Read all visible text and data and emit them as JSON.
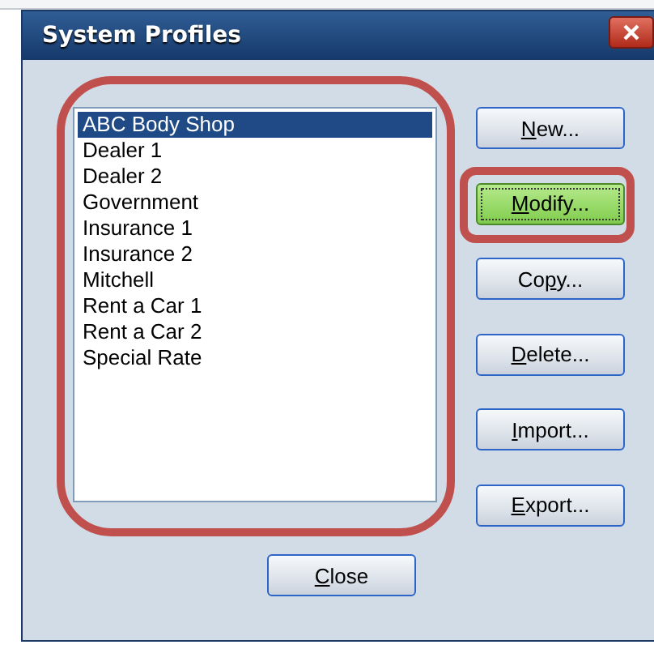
{
  "window": {
    "title": "System Profiles"
  },
  "profiles": [
    {
      "name": "ABC Body Shop",
      "selected": true
    },
    {
      "name": "Dealer 1",
      "selected": false
    },
    {
      "name": "Dealer 2",
      "selected": false
    },
    {
      "name": "Government",
      "selected": false
    },
    {
      "name": "Insurance 1",
      "selected": false
    },
    {
      "name": "Insurance 2",
      "selected": false
    },
    {
      "name": "Mitchell",
      "selected": false
    },
    {
      "name": "Rent a Car 1",
      "selected": false
    },
    {
      "name": "Rent a Car 2",
      "selected": false
    },
    {
      "name": "Special Rate",
      "selected": false
    }
  ],
  "buttons": [
    {
      "mnemonic": "N",
      "label_rest": "ew...",
      "focused": false
    },
    {
      "mnemonic": "M",
      "label_rest": "odify...",
      "focused": true
    },
    {
      "label_start": "Co",
      "mnemonic": "p",
      "label_rest": "y...",
      "focused": false
    },
    {
      "mnemonic": "D",
      "label_rest": "elete...",
      "focused": false
    },
    {
      "mnemonic": "I",
      "label_rest": "mport...",
      "focused": false
    },
    {
      "mnemonic": "E",
      "label_rest": "xport...",
      "focused": false
    }
  ],
  "close_button": {
    "mnemonic": "C",
    "label_rest": "lose"
  }
}
